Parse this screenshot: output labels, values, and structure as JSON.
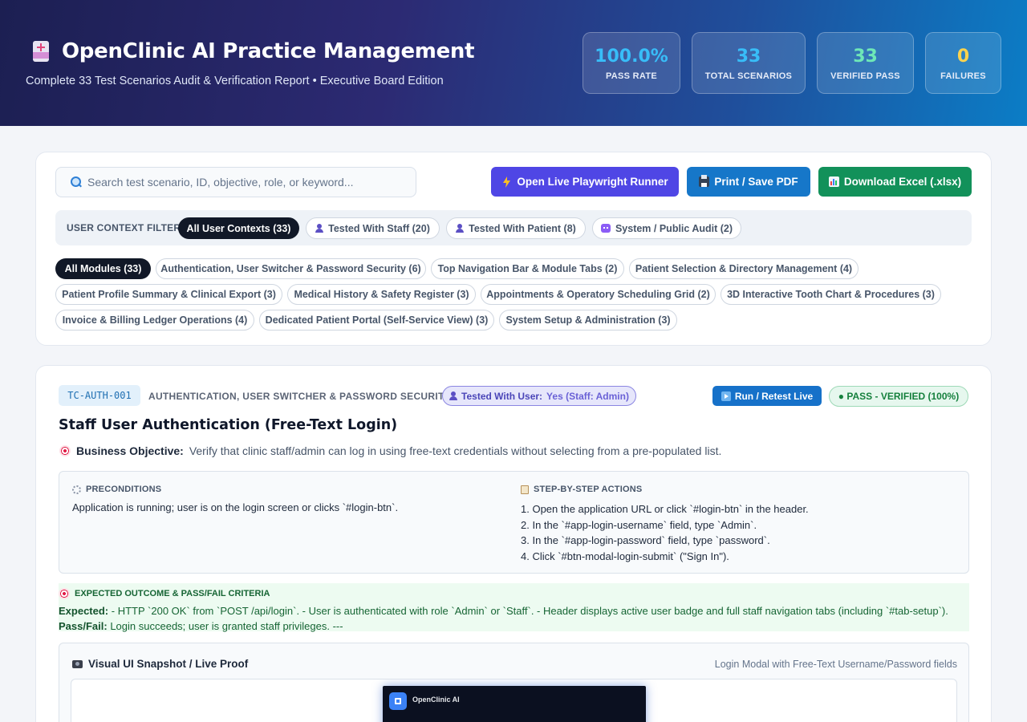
{
  "header": {
    "title": "OpenClinic AI Practice Management",
    "subtitle": "Complete 33 Test Scenarios Audit & Verification Report • Executive Board Edition",
    "stats": [
      {
        "value": "100.0%",
        "label": "PASS RATE",
        "color": "#38bdf8"
      },
      {
        "value": "33",
        "label": "TOTAL SCENARIOS",
        "color": "#38bdf8"
      },
      {
        "value": "33",
        "label": "VERIFIED PASS",
        "color": "#6ee7b7"
      },
      {
        "value": "0",
        "label": "FAILURES",
        "color": "#fcd34d"
      }
    ]
  },
  "toolbar": {
    "search_placeholder": "Search test scenario, ID, objective, role, or keyword...",
    "runner_label": "Open Live Playwright Runner",
    "print_label": "Print / Save PDF",
    "excel_label": "Download Excel (.xlsx)",
    "runner_color": "#4f46e5",
    "print_color": "#1677c9",
    "excel_color": "#12915a"
  },
  "context_filter": {
    "label": "USER CONTEXT FILTER:",
    "options": [
      {
        "label": "All User Contexts (33)",
        "icon": "",
        "active": true
      },
      {
        "label": "Tested With Staff (20)",
        "icon": "person-icon",
        "active": false
      },
      {
        "label": "Tested With Patient (8)",
        "icon": "person-icon",
        "active": false
      },
      {
        "label": "System / Public Audit (2)",
        "icon": "robot-icon",
        "active": false
      }
    ]
  },
  "modules": [
    {
      "label": "All Modules (33)",
      "active": true
    },
    {
      "label": "Authentication, User Switcher & Password Security (6)",
      "active": false
    },
    {
      "label": "Top Navigation Bar & Module Tabs (2)",
      "active": false
    },
    {
      "label": "Patient Selection & Directory Management (4)",
      "active": false
    },
    {
      "label": "Patient Profile Summary & Clinical Export (3)",
      "active": false
    },
    {
      "label": "Medical History & Safety Register (3)",
      "active": false
    },
    {
      "label": "Appointments & Operatory Scheduling Grid (2)",
      "active": false
    },
    {
      "label": "3D Interactive Tooth Chart & Procedures (3)",
      "active": false
    },
    {
      "label": "Invoice & Billing Ledger Operations (4)",
      "active": false
    },
    {
      "label": "Dedicated Patient Portal (Self-Service View) (3)",
      "active": false
    },
    {
      "label": "System Setup & Administration (3)",
      "active": false
    }
  ],
  "test_case": {
    "id": "TC-AUTH-001",
    "module": "AUTHENTICATION, USER SWITCHER & PASSWORD SECURITY",
    "tested_with_label": "Tested With User:",
    "tested_with_value": "Yes (Staff: Admin)",
    "run_label": "Run / Retest Live",
    "status": "● PASS - VERIFIED (100%)",
    "title": "Staff User Authentication (Free-Text Login)",
    "objective_label": "Business Objective:",
    "objective": "Verify that clinic staff/admin can log in using free-text credentials without selecting from a pre-populated list.",
    "preconditions_heading": "PRECONDITIONS",
    "preconditions": "Application is running; user is on the login screen or clicks `#login-btn`.",
    "steps_heading": "STEP-BY-STEP ACTIONS",
    "steps": [
      "1. Open the application URL or click `#login-btn` in the header.",
      "2. In the `#app-login-username` field, type `Admin`.",
      "3. In the `#app-login-password` field, type `password`.",
      "4. Click `#btn-modal-login-submit` (\"Sign In\")."
    ],
    "expected_heading": "EXPECTED OUTCOME & PASS/FAIL CRITERIA",
    "expected_label": "Expected:",
    "expected": "- HTTP `200 OK` from `POST /api/login`. - User is authenticated with role `Admin` or `Staff`. - Header displays active user badge and full staff navigation tabs (including `#tab-setup`).",
    "passfail_label": "Pass/Fail:",
    "passfail": "Login succeeds; user is granted staff privileges. ---",
    "snapshot_heading": "Visual UI Snapshot / Live Proof",
    "snapshot_caption": "Login Modal with Free-Text Username/Password fields",
    "snapshot_app_title": "OpenClinic AI"
  }
}
